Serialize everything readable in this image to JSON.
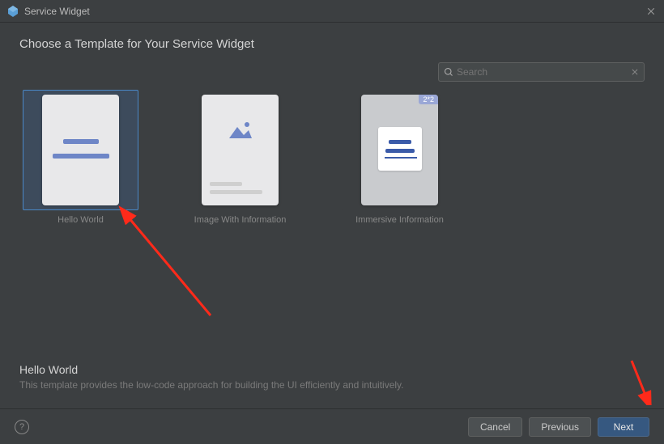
{
  "titlebar": {
    "title": "Service Widget"
  },
  "heading": "Choose a Template for Your Service Widget",
  "search": {
    "placeholder": "Search",
    "value": ""
  },
  "templates": [
    {
      "label": "Hello World",
      "selected": true
    },
    {
      "label": "Image With Information",
      "selected": false
    },
    {
      "label": "Immersive Information",
      "selected": false,
      "badge": "2*2"
    }
  ],
  "description": {
    "title": "Hello World",
    "text": "This template provides the low-code approach for building the UI efficiently and intuitively."
  },
  "footer": {
    "cancel": "Cancel",
    "previous": "Previous",
    "next": "Next"
  }
}
